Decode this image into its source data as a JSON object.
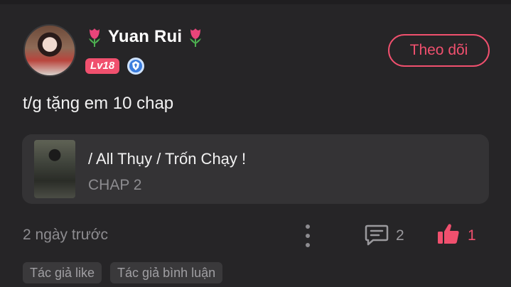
{
  "user": {
    "name": "Yuan Rui",
    "level": "Lv18",
    "name_decoration_icon": "tulip-icon",
    "badge_icon": "shield-badge-icon"
  },
  "follow_button": {
    "label": "Theo dõi"
  },
  "comment": {
    "text": "t/g tặng em 10 chap"
  },
  "manga": {
    "title": "/ All Thụy / Trốn Chạy !",
    "chapter": "CHAP 2"
  },
  "meta": {
    "time": "2 ngày trước",
    "comment_count": "2",
    "like_count": "1"
  },
  "tags": [
    "Tác giả like",
    "Tác giả bình luận"
  ],
  "colors": {
    "background": "#262527",
    "accent": "#f0506e",
    "card": "#343335",
    "muted_text": "#8d8c90"
  }
}
